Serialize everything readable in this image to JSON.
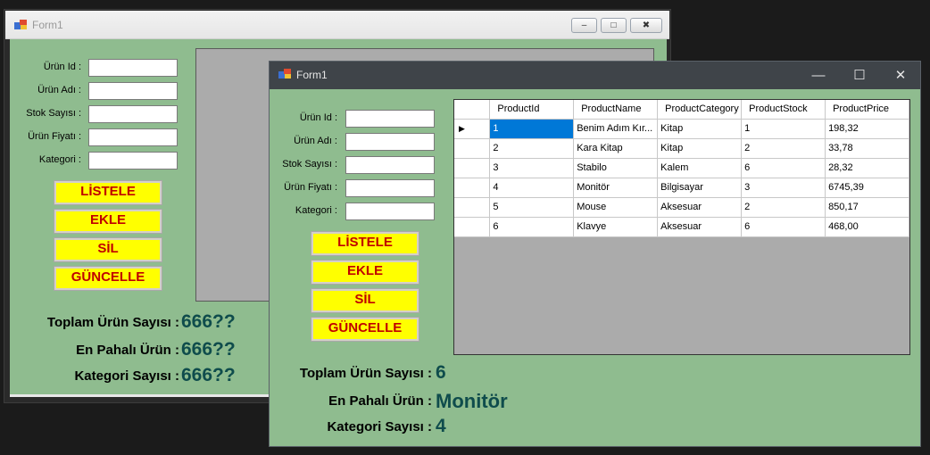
{
  "back_window": {
    "title": "Form1",
    "controls": {
      "minimize": "–",
      "maximize": "□",
      "close": "✖"
    },
    "fields": [
      {
        "label": "Ürün Id :",
        "value": ""
      },
      {
        "label": "Ürün Adı :",
        "value": ""
      },
      {
        "label": "Stok Sayısı :",
        "value": ""
      },
      {
        "label": "Ürün Fiyatı :",
        "value": ""
      },
      {
        "label": "Kategori :",
        "value": ""
      }
    ],
    "buttons": {
      "list": "LİSTELE",
      "add": "EKLE",
      "delete": "SİL",
      "update": "GÜNCELLE"
    },
    "stats": [
      {
        "label": "Toplam Ürün Sayısı :",
        "value": "666??"
      },
      {
        "label": "En Pahalı Ürün :",
        "value": "666??"
      },
      {
        "label": "Kategori Sayısı :",
        "value": "666??"
      }
    ]
  },
  "front_window": {
    "title": "Form1",
    "controls": {
      "minimize": "—",
      "maximize": "☐",
      "close": "✕"
    },
    "fields": [
      {
        "label": "Ürün Id :",
        "value": ""
      },
      {
        "label": "Ürün Adı :",
        "value": ""
      },
      {
        "label": "Stok Sayısı :",
        "value": ""
      },
      {
        "label": "Ürün Fiyatı :",
        "value": ""
      },
      {
        "label": "Kategori :",
        "value": ""
      }
    ],
    "buttons": {
      "list": "LİSTELE",
      "add": "EKLE",
      "delete": "SİL",
      "update": "GÜNCELLE"
    },
    "grid": {
      "columns": [
        "ProductId",
        "ProductName",
        "ProductCategory",
        "ProductStock",
        "ProductPrice"
      ],
      "current_row_marker": "▶",
      "rows": [
        [
          "1",
          "Benim Adım Kır...",
          "Kitap",
          "1",
          "198,32"
        ],
        [
          "2",
          "Kara Kitap",
          "Kitap",
          "2",
          "33,78"
        ],
        [
          "3",
          "Stabilo",
          "Kalem",
          "6",
          "28,32"
        ],
        [
          "4",
          "Monitör",
          "Bilgisayar",
          "3",
          "6745,39"
        ],
        [
          "5",
          "Mouse",
          "Aksesuar",
          "2",
          "850,17"
        ],
        [
          "6",
          "Klavye",
          "Aksesuar",
          "6",
          "468,00"
        ]
      ]
    },
    "stats": [
      {
        "label": "Toplam Ürün Sayısı :",
        "value": "6"
      },
      {
        "label": "En Pahalı Ürün :",
        "value": "Monitör"
      },
      {
        "label": "Kategori Sayısı :",
        "value": "4"
      }
    ]
  },
  "colors": {
    "form_background": "#8fbc8f",
    "button_background": "#ffff00",
    "button_text": "#c00000",
    "stat_value": "#0f4c4c",
    "selection": "#0078d7"
  }
}
